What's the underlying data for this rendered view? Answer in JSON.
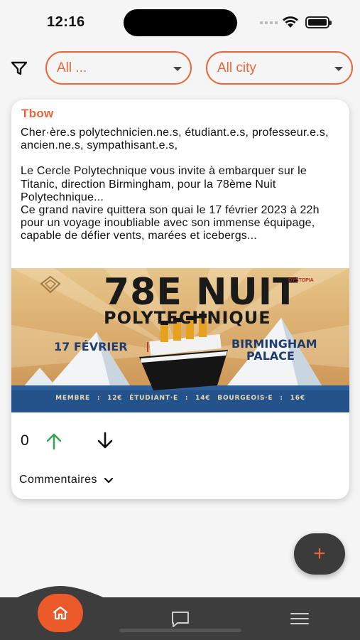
{
  "status_bar": {
    "time": "12:16"
  },
  "filters": {
    "category_value": "All ...",
    "city_value": "All city"
  },
  "post": {
    "author": "Tbow",
    "paragraphs": [
      "Cher·ère.s polytechnicien.ne.s, étudiant.e.s, professeur.e.s, ancien.ne.s, sympathisant.e.s,",
      "Le Cercle Polytechnique vous invite à embarquer sur le Titanic, direction Birmingham, pour la 78ème Nuit Polytechnique...",
      "Ce grand navire quittera son quai le 17 février 2023 à 22h pour un voyage inoubliable avec son immense équipage, capable de défier vents, marées et icebergs..."
    ],
    "poster": {
      "title_line1": "78E NUIT",
      "title_line2": "POLYTECHNIQUE",
      "date": "17 FÉVRIER",
      "place": "BIRMINGHAM PALACE",
      "prices": "MEMBRE : 12€   ÉTUDIANT·E : 14€   BOURGEOIS·E : 16€",
      "sponsor": "DYSTOPIA"
    },
    "score": "0",
    "comments_label": "Commentaires"
  },
  "colors": {
    "accent": "#e8663c",
    "upvote": "#3aa35a",
    "nav_bg": "#3d3d3d",
    "fab_bg": "#3b3b3b"
  },
  "icons": {
    "filter": "filter-icon",
    "upvote": "arrow-up-icon",
    "downvote": "arrow-down-icon",
    "expand": "chevron-down-icon",
    "add": "plus-icon",
    "home": "home-icon",
    "chat": "chat-icon",
    "menu": "menu-icon"
  }
}
